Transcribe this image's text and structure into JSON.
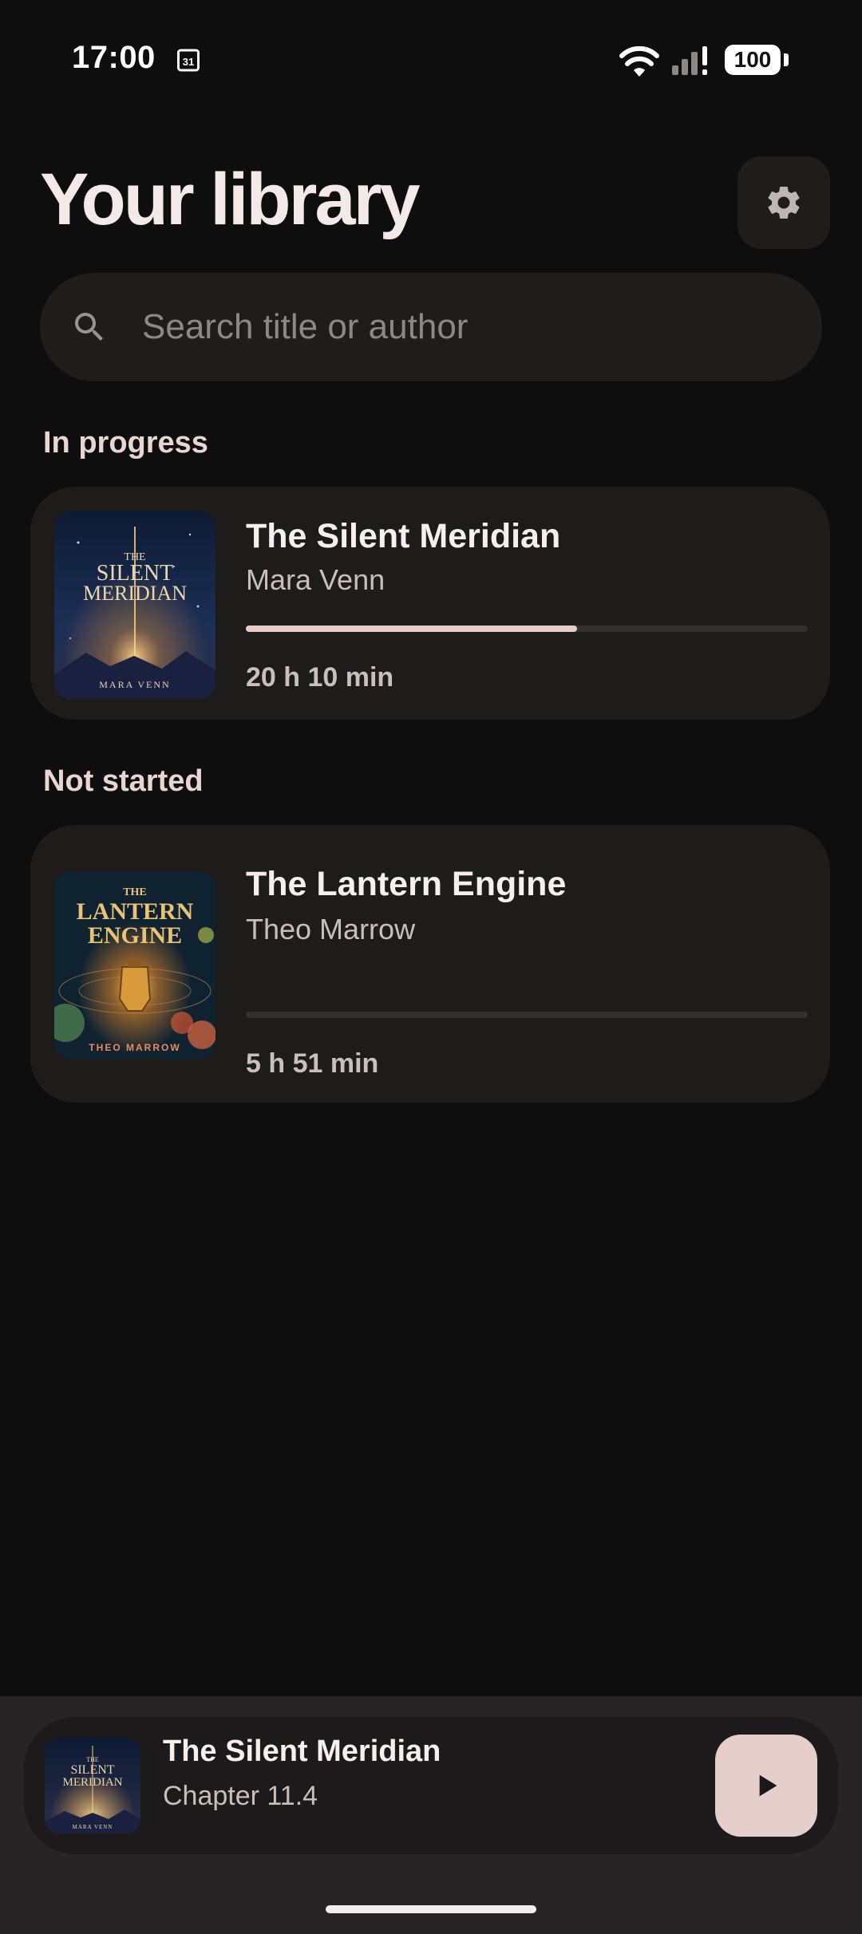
{
  "status_bar": {
    "time": "17:00",
    "calendar_day": "31",
    "battery": "100",
    "icons": [
      "calendar-icon",
      "wifi-icon",
      "signal-icon",
      "battery-icon"
    ]
  },
  "header": {
    "title": "Your library",
    "settings_icon": "gear-icon"
  },
  "search": {
    "placeholder": "Search title or author",
    "value": ""
  },
  "sections": [
    {
      "label": "In progress",
      "books": [
        {
          "title": "The Silent Meridian",
          "author": "Mara Venn",
          "duration": "20 h 10 min",
          "progress": 0.59,
          "cover": {
            "lines": [
              "THE",
              "SILENT",
              "MERIDIAN"
            ],
            "author": "MARA VENN"
          }
        }
      ]
    },
    {
      "label": "Not started",
      "books": [
        {
          "title": "The Lantern Engine",
          "author": "Theo Marrow",
          "duration": "5 h 51 min",
          "progress": 0,
          "cover": {
            "lines": [
              "THE",
              "LANTERN",
              "ENGINE"
            ],
            "author": "THEO MARROW"
          }
        }
      ]
    }
  ],
  "mini_player": {
    "title": "The Silent Meridian",
    "subtitle": "Chapter 11.4",
    "play_icon": "play-icon"
  },
  "colors": {
    "background": "#0f0e0e",
    "card": "#1e1b1b",
    "accent": "#e6cfca",
    "text_primary": "#f6efed",
    "text_secondary": "#c8bfbc"
  }
}
